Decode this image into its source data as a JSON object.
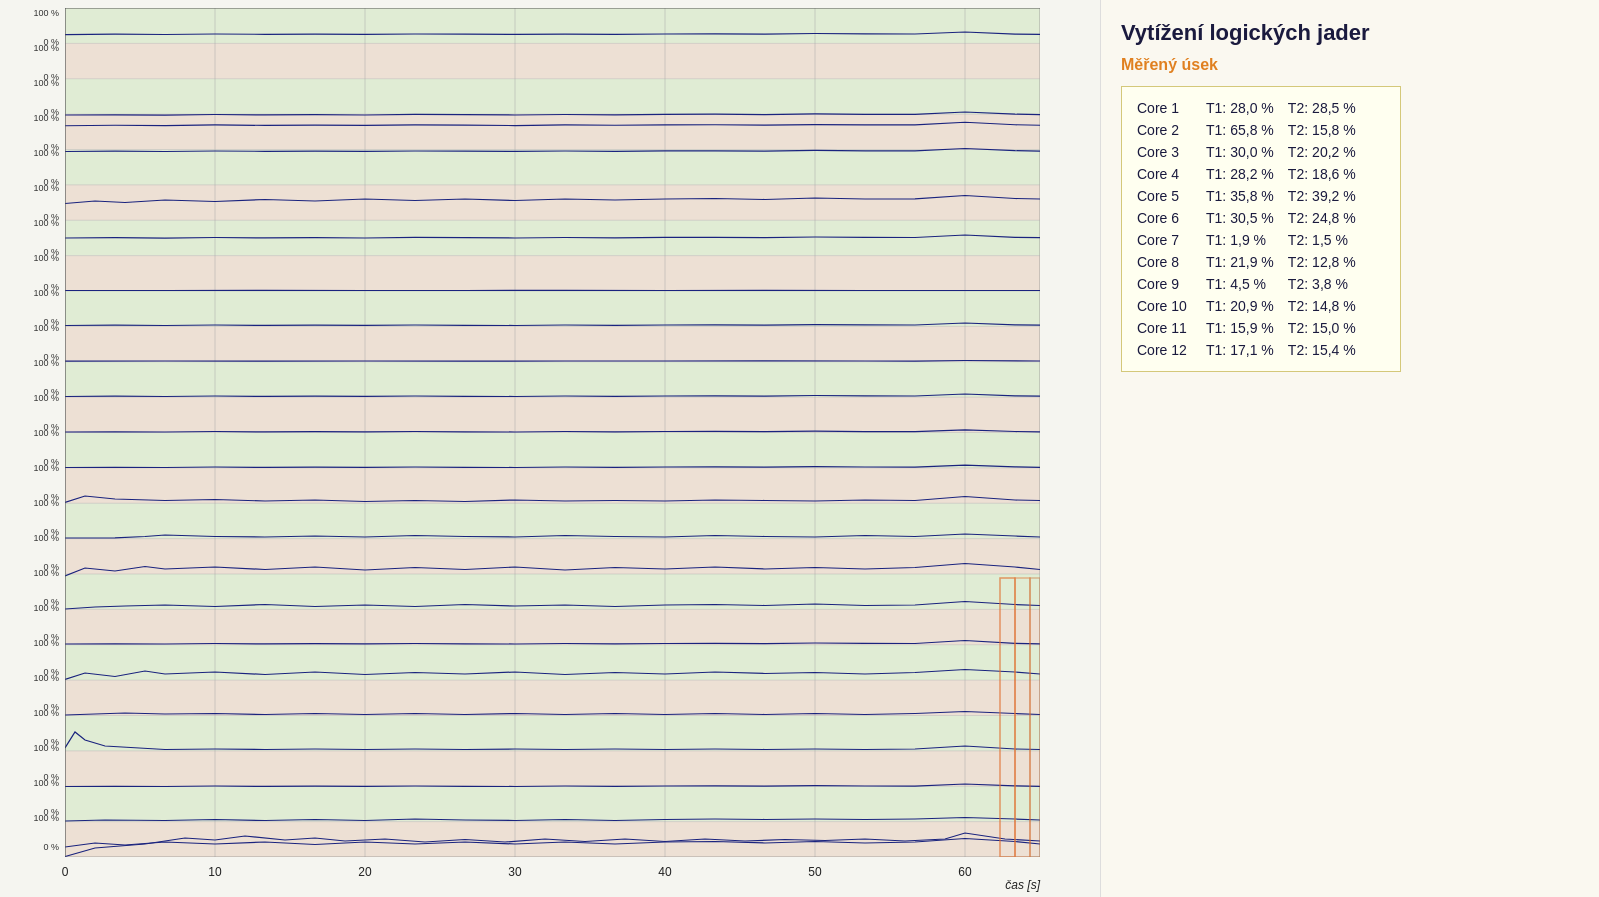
{
  "title": "Vytížení logických jader",
  "section": "Měřený úsek",
  "cores": [
    {
      "name": "Core 1",
      "t1": "28,0 %",
      "t2": "28,5 %"
    },
    {
      "name": "Core 2",
      "t1": "65,8 %",
      "t2": "15,8 %"
    },
    {
      "name": "Core 3",
      "t1": "30,0 %",
      "t2": "20,2 %"
    },
    {
      "name": "Core 4",
      "t1": "28,2 %",
      "t2": "18,6 %"
    },
    {
      "name": "Core 5",
      "t1": "35,8 %",
      "t2": "39,2 %"
    },
    {
      "name": "Core 6",
      "t1": "30,5 %",
      "t2": "24,8 %"
    },
    {
      "name": "Core 7",
      "t1": "1,9 %",
      "t2": "1,5 %"
    },
    {
      "name": "Core 8",
      "t1": "21,9 %",
      "t2": "12,8 %"
    },
    {
      "name": "Core 9",
      "t1": "4,5 %",
      "t2": "3,8 %"
    },
    {
      "name": "Core 10",
      "t1": "20,9 %",
      "t2": "14,8 %"
    },
    {
      "name": "Core 11",
      "t1": "15,9 %",
      "t2": "15,0 %"
    },
    {
      "name": "Core 12",
      "t1": "17,1 %",
      "t2": "15,4 %"
    }
  ],
  "xaxis": {
    "labels": [
      "0",
      "10",
      "20",
      "30",
      "40",
      "50",
      "60"
    ],
    "unit": "čas [s]",
    "max": 65
  },
  "chart": {
    "num_cores": 24,
    "colors": {
      "row_even": "#e8f0e0",
      "row_odd": "#f0e8e0",
      "line": "#1a237e",
      "grid": "#b0b0a0"
    }
  }
}
